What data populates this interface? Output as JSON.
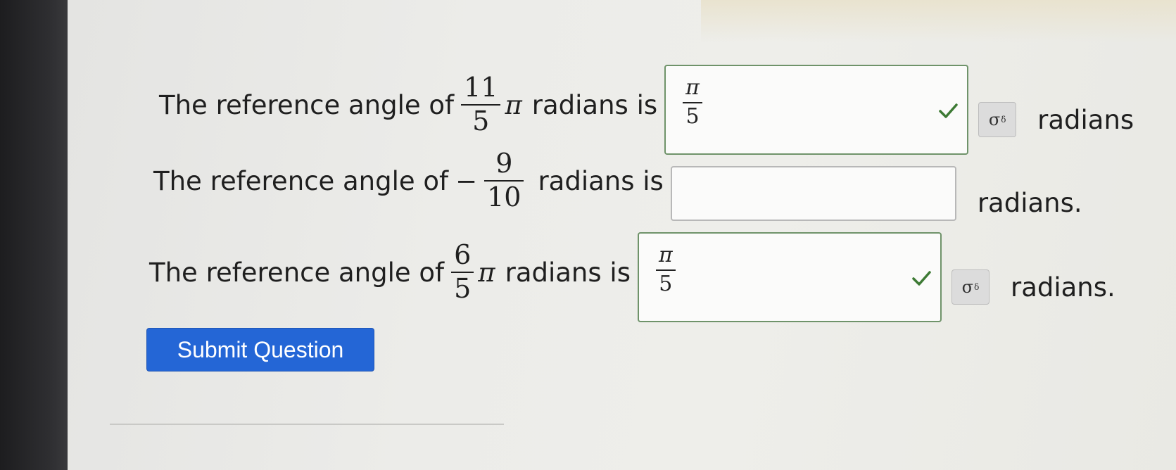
{
  "questions": [
    {
      "prefix": "The reference angle of",
      "fraction": {
        "numerator": "11",
        "denominator": "5",
        "sign": ""
      },
      "pi": "π",
      "middle": "radians is",
      "answer": {
        "numerator": "π",
        "denominator": "5",
        "status": "correct"
      },
      "unit": "radians"
    },
    {
      "prefix": "The reference angle of",
      "fraction": {
        "numerator": "9",
        "denominator": "10",
        "sign": "−"
      },
      "pi": "",
      "middle": "radians is",
      "answer": {
        "numerator": "",
        "denominator": "",
        "status": "empty"
      },
      "unit": "radians."
    },
    {
      "prefix": "The reference angle of",
      "fraction": {
        "numerator": "6",
        "denominator": "5",
        "sign": ""
      },
      "pi": "π",
      "middle": "radians is",
      "answer": {
        "numerator": "π",
        "denominator": "5",
        "status": "correct"
      },
      "unit": "radians."
    }
  ],
  "preview_button": {
    "label": "σ",
    "sup": "δ"
  },
  "submit": {
    "label": "Submit Question"
  },
  "colors": {
    "accent": "#2466d6",
    "correct": "#3d7a34"
  }
}
